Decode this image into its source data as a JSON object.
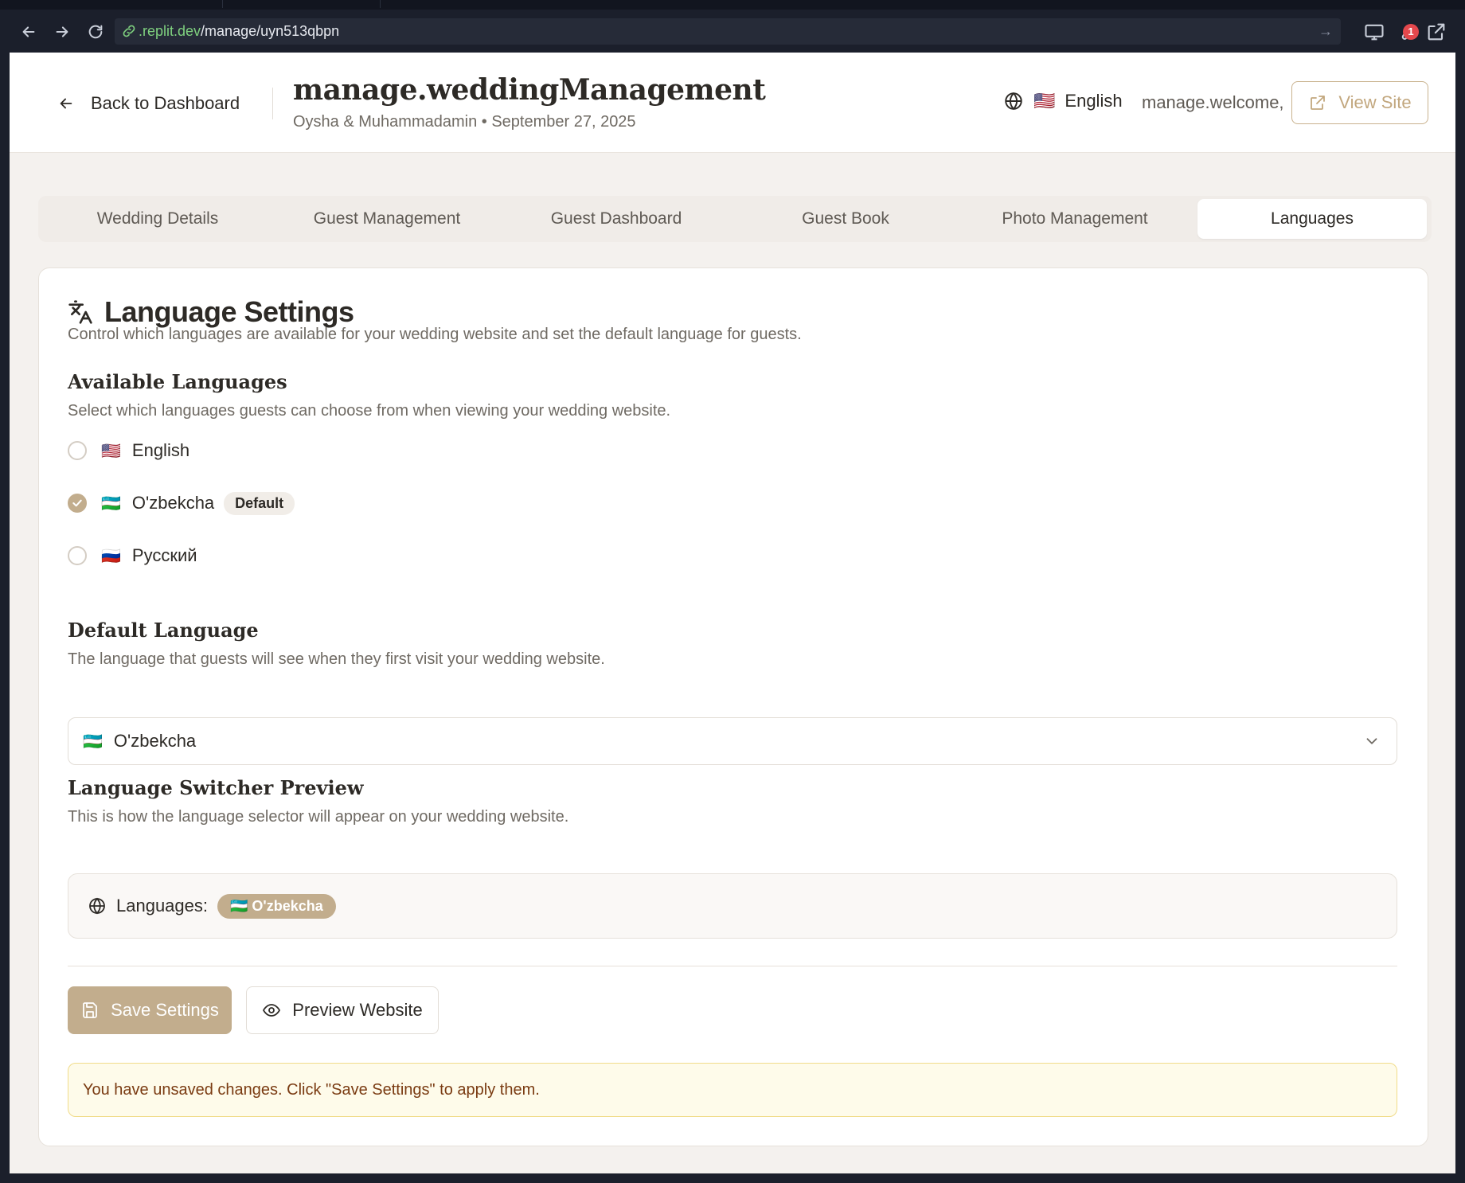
{
  "browser": {
    "url_domain": ".replit.dev",
    "url_path": "/manage/uyn513qbpn",
    "notification_count": "1"
  },
  "header": {
    "back_label": "Back to Dashboard",
    "title": "manage.weddingManagement",
    "subtitle": "Oysha & Muhammadamin • September 27, 2025",
    "language_flag": "🇺🇸",
    "language_label": "English",
    "welcome": "manage.welcome,",
    "view_site": "View Site"
  },
  "tabs": [
    {
      "label": "Wedding Details"
    },
    {
      "label": "Guest Management"
    },
    {
      "label": "Guest Dashboard"
    },
    {
      "label": "Guest Book"
    },
    {
      "label": "Photo Management"
    },
    {
      "label": "Languages",
      "active": true
    }
  ],
  "settings": {
    "title": "Language Settings",
    "description": "Control which languages are available for your wedding website and set the default language for guests.",
    "available": {
      "heading": "Available Languages",
      "description": "Select which languages guests can choose from when viewing your wedding website.",
      "languages": [
        {
          "flag": "🇺🇸",
          "name": "English",
          "checked": false
        },
        {
          "flag": "🇺🇿",
          "name": "O'zbekcha",
          "checked": true,
          "badge": "Default"
        },
        {
          "flag": "🇷🇺",
          "name": "Русский",
          "checked": false
        }
      ]
    },
    "default": {
      "heading": "Default Language",
      "description": "The language that guests will see when they first visit your wedding website.",
      "selected_flag": "🇺🇿",
      "selected": "O'zbekcha"
    },
    "preview": {
      "heading": "Language Switcher Preview",
      "description": "This is how the language selector will appear on your wedding website.",
      "label": "Languages:",
      "pill": "🇺🇿 O'zbekcha"
    },
    "save_label": "Save Settings",
    "preview_label": "Preview Website",
    "warning": "You have unsaved changes. Click \"Save Settings\" to apply them."
  },
  "colors": {
    "accent": "#c2ad8d",
    "page_bg": "#f4f1ee",
    "warning_bg": "#fefbea",
    "warning_text": "#7a3b12"
  }
}
